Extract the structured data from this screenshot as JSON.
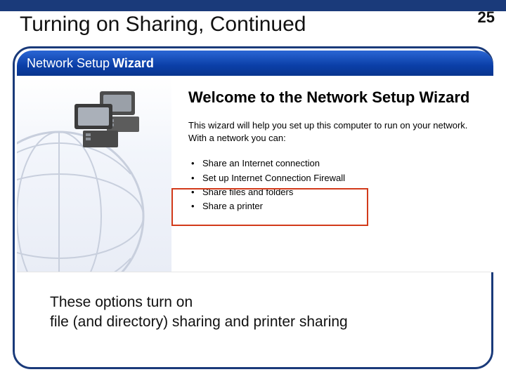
{
  "slide": {
    "title": "Turning on Sharing, Continued",
    "page_number": "25",
    "caption_line1": "These options turn on",
    "caption_line2": "file (and directory) sharing and printer sharing"
  },
  "wizard": {
    "titlebar_prefix": "Network Setup",
    "titlebar_suffix": "Wizard",
    "heading": "Welcome to the Network Setup Wizard",
    "intro": "This wizard will help you set up this computer to run on your network. With a network you can:",
    "bullets": [
      "Share an Internet connection",
      "Set up Internet Connection Firewall",
      "Share files and folders",
      "Share a printer"
    ]
  },
  "icons": {
    "computers": "computers-icon",
    "globe": "globe-wireframe-icon"
  }
}
